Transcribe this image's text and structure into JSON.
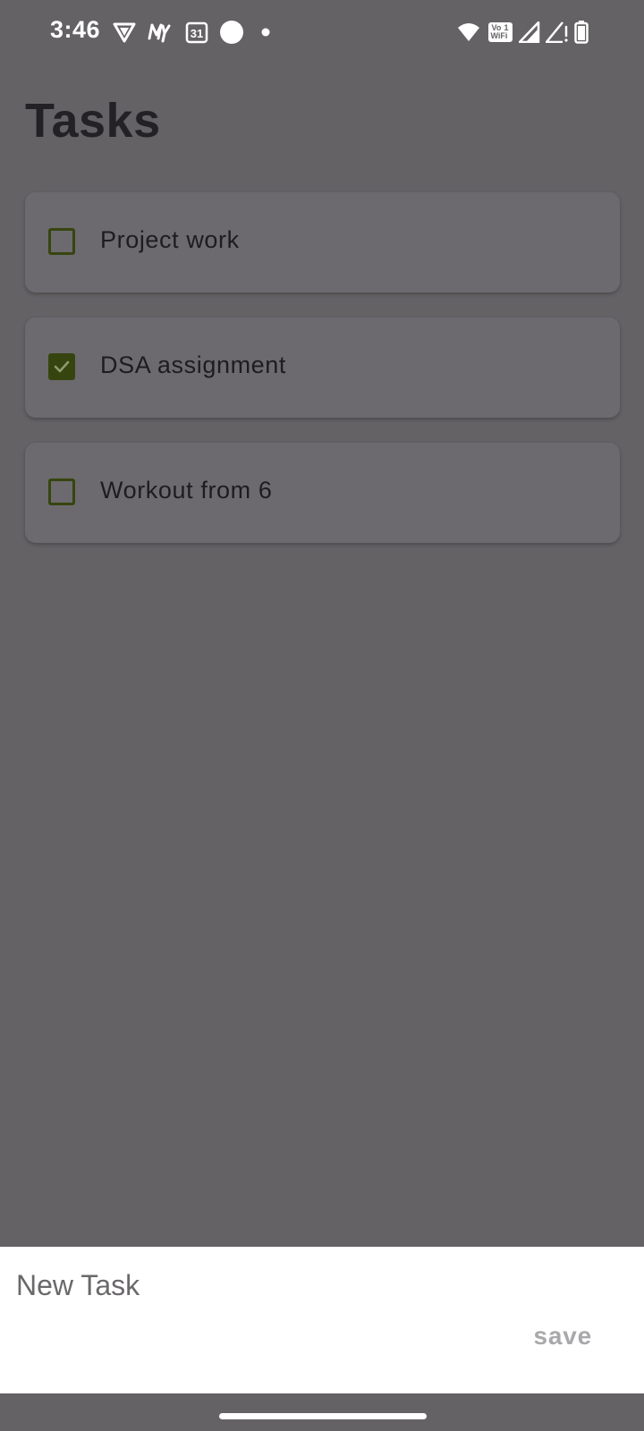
{
  "status_bar": {
    "time": "3:46",
    "calendar_day": "31",
    "volte_label": "Vo",
    "volte_sub": "WiFi",
    "sim_slot": "1",
    "icons": [
      "vpn-shield-icon",
      "my-app-icon",
      "calendar-icon",
      "circle-notification-icon",
      "dot-notification-icon",
      "wifi-icon",
      "volte-wifi-icon",
      "signal-icon",
      "signal-no-service-icon",
      "battery-icon"
    ]
  },
  "header": {
    "title": "Tasks"
  },
  "tasks": [
    {
      "label": "Project work",
      "checked": false
    },
    {
      "label": "DSA assignment",
      "checked": true
    },
    {
      "label": "Workout from 6",
      "checked": false
    }
  ],
  "bottom_sheet": {
    "input_placeholder": "New Task",
    "input_value": "",
    "save_label": "save"
  },
  "colors": {
    "scrim_background": "#646265",
    "checkbox_accent": "#36450f",
    "sheet_background": "#ffffff",
    "save_disabled": "#a9a9ab"
  }
}
